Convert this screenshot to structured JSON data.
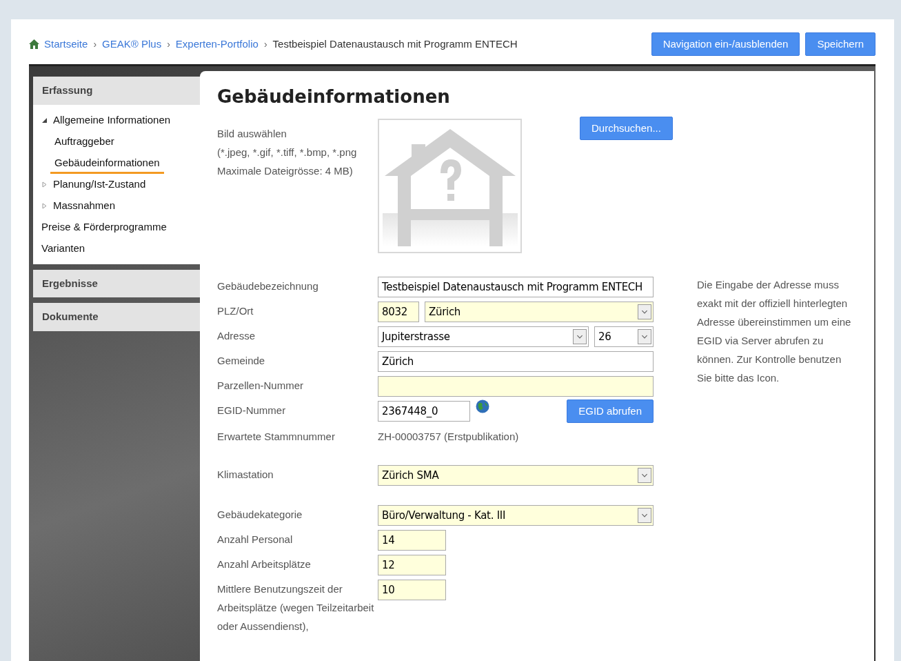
{
  "breadcrumb": [
    {
      "label": "Startseite",
      "link": true
    },
    {
      "separator": "›",
      "label": "GEAK® Plus",
      "link": true
    },
    {
      "separator": "›",
      "label": "Experten-Portfolio",
      "link": true
    },
    {
      "separator": "›",
      "label": "Testbeispiel Datenaustausch mit Programm ENTECH",
      "link": false
    }
  ],
  "header_buttons": [
    "Navigation ein-/ausblenden",
    "Speichern"
  ],
  "sidebar": [
    {
      "title": "Erfassung",
      "expanded": true,
      "items": [
        {
          "label": "Allgemeine Informationen",
          "expanded": true,
          "selected": false,
          "children": [
            {
              "label": "Auftraggeber",
              "selected": false
            },
            {
              "label": "Gebäudeinformationen",
              "selected": true
            }
          ]
        },
        {
          "label": "Planung/Ist-Zustand",
          "expanded": false,
          "selected": false
        },
        {
          "label": "Massnahmen",
          "expanded": false,
          "selected": false
        },
        {
          "label": "Preise & Förderprogramme",
          "selected": false
        },
        {
          "label": "Varianten",
          "selected": false
        }
      ]
    },
    {
      "title": "Ergebnisse",
      "expanded": false
    },
    {
      "title": "Dokumente",
      "expanded": false
    }
  ],
  "page_title": "Gebäudeinformationen",
  "image_upload": {
    "lines": [
      "Bild auswählen",
      "(*.jpeg, *.gif, *.tiff, *.bmp, *.png",
      "Maximale Dateigrösse: 4 MB)"
    ],
    "button": "Durchsuchen..."
  },
  "help_text": "Die Eingabe der Adresse muss exakt mit der offiziell hinterlegten Adresse übereinstimmen um eine EGID via Server abrufen zu können. Zur Kontrolle benutzen Sie bitte das Icon.",
  "groups": [
    {
      "rows": [
        {
          "label": "Gebäudebezeichnung",
          "controls": [
            {
              "kind": "input",
              "value": "Testbeispiel Datenaustausch mit Programm ENTECH",
              "required": false
            }
          ]
        },
        {
          "label": "PLZ/Ort",
          "controls": [
            {
              "kind": "tiny_input",
              "value": "8032",
              "required": true
            },
            {
              "kind": "select",
              "value": "Zürich",
              "required": true
            }
          ]
        },
        {
          "label": "Adresse",
          "controls": [
            {
              "kind": "select",
              "value": "Jupiterstrasse",
              "required": false
            },
            {
              "kind": "short_select",
              "value": "26",
              "required": false
            }
          ]
        },
        {
          "label": "Gemeinde",
          "controls": [
            {
              "kind": "input",
              "value": "Zürich",
              "required": false
            }
          ]
        },
        {
          "label": "Parzellen-Nummer",
          "controls": [
            {
              "kind": "input",
              "required": true
            }
          ]
        },
        {
          "label": "EGID-Nummer",
          "controls": [
            {
              "kind": "medium_input",
              "value": "2367448_0",
              "required": false
            },
            {
              "kind": "globe"
            },
            {
              "kind": "button",
              "value": "EGID abrufen"
            }
          ]
        },
        {
          "label": "Erwartete Stammnummer",
          "controls": [
            {
              "kind": "text",
              "value": "ZH-00003757 (Erstpublikation)"
            }
          ]
        }
      ]
    },
    {
      "rows": [
        {
          "label": "Klimastation",
          "controls": [
            {
              "kind": "select",
              "value": "Zürich SMA",
              "required": true
            }
          ]
        }
      ]
    },
    {
      "rows": [
        {
          "label": "Gebäudekategorie",
          "controls": [
            {
              "kind": "select",
              "value": "Büro/Verwaltung - Kat. III",
              "required": true
            }
          ]
        },
        {
          "label": "Anzahl Personal",
          "controls": [
            {
              "kind": "short_input",
              "value": "14",
              "required": true
            }
          ]
        },
        {
          "label": "Anzahl Arbeitsplätze",
          "controls": [
            {
              "kind": "short_input",
              "value": "12",
              "required": true
            }
          ]
        },
        {
          "label": "Mittlere Benutzungszeit der Arbeitsplätze (wegen Teilzeitarbeit oder Aussendienst),",
          "controls": [
            {
              "kind": "short_input",
              "value": "10",
              "required": true
            }
          ]
        }
      ]
    }
  ]
}
